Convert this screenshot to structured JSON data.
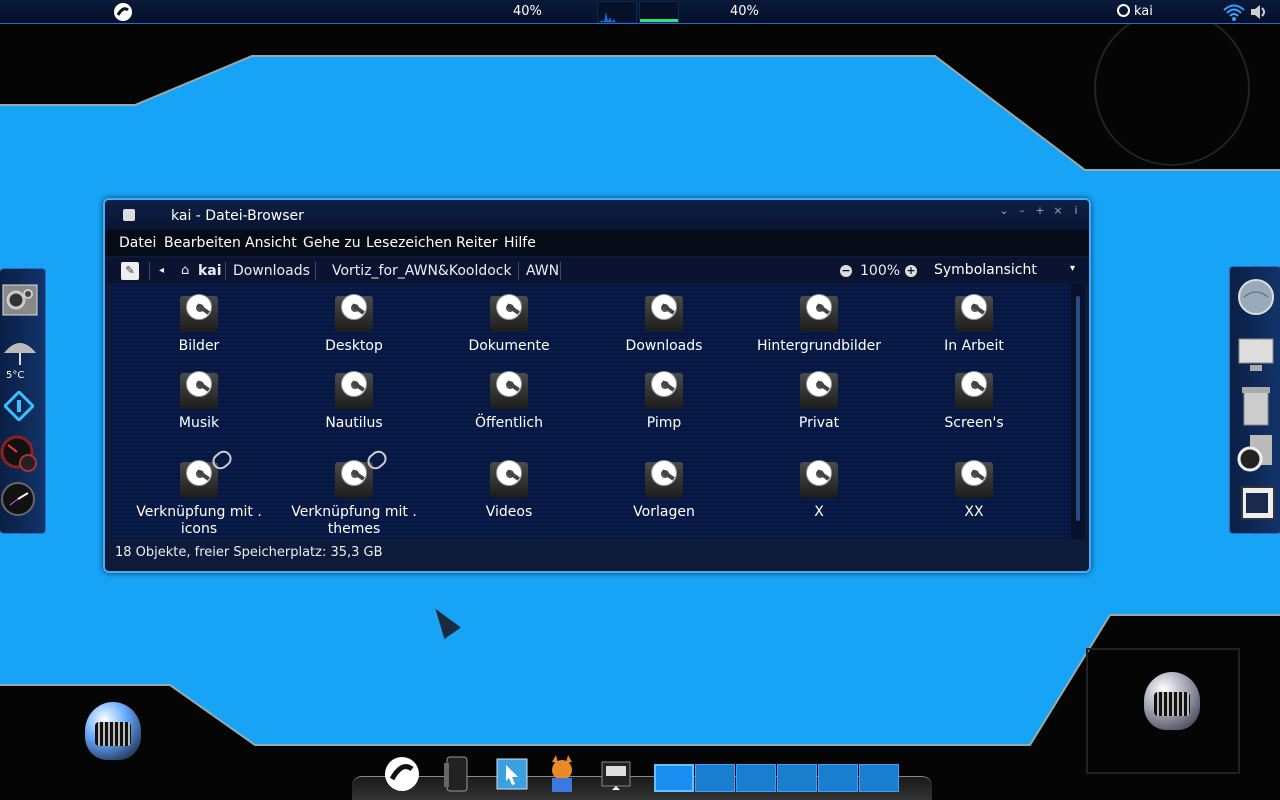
{
  "top_panel": {
    "cpu_percent": "40%",
    "mem_percent": "40%",
    "user": "kai",
    "icons": [
      "logo-icon",
      "power-icon",
      "wifi-icon",
      "volume-icon"
    ]
  },
  "left_dock": {
    "icons": [
      "settings-icon",
      "weather-icon",
      "navigation-icon",
      "gauge-icon",
      "clock-icon"
    ],
    "weather_temp": "5°C"
  },
  "right_dock": {
    "icons": [
      "globe-icon",
      "monitor-icon",
      "trash-icon",
      "disk-settings-icon",
      "window-icon"
    ]
  },
  "window": {
    "title": "kai - Datei-Browser",
    "menu": [
      "Datei",
      "Bearbeiten",
      "Ansicht",
      "Gehe zu",
      "Lesezeichen",
      "Reiter",
      "Hilfe"
    ],
    "path": [
      "kai",
      "Downloads",
      "Vortiz_for_AWN&Kooldock",
      "AWN"
    ],
    "zoom": "100%",
    "view_mode": "Symbolansicht",
    "items": [
      {
        "label": "Bilder"
      },
      {
        "label": "Desktop"
      },
      {
        "label": "Dokumente"
      },
      {
        "label": "Downloads"
      },
      {
        "label": "Hintergrundbilder"
      },
      {
        "label": "In Arbeit"
      },
      {
        "label": "Musik"
      },
      {
        "label": "Nautilus"
      },
      {
        "label": "Öffentlich"
      },
      {
        "label": "Pimp"
      },
      {
        "label": "Privat"
      },
      {
        "label": "Screen's"
      },
      {
        "label": "Verknüpfung mit .\nicons",
        "link": true
      },
      {
        "label": "Verknüpfung mit .\nthemes",
        "link": true
      },
      {
        "label": "Videos"
      },
      {
        "label": "Vorlagen"
      },
      {
        "label": "X"
      },
      {
        "label": "XX"
      }
    ],
    "status": "18 Objekte, freier Speicherplatz: 35,3 GB"
  },
  "bottom_dock": {
    "icons": [
      "logo-icon",
      "phone-icon",
      "cursor-icon",
      "fox-icon",
      "file-manager-icon"
    ],
    "workspaces": 6
  },
  "colors": {
    "desktop_bg": "#17a3f6",
    "window_bg": "#0d1a38",
    "accent": "#4aa8ff"
  }
}
